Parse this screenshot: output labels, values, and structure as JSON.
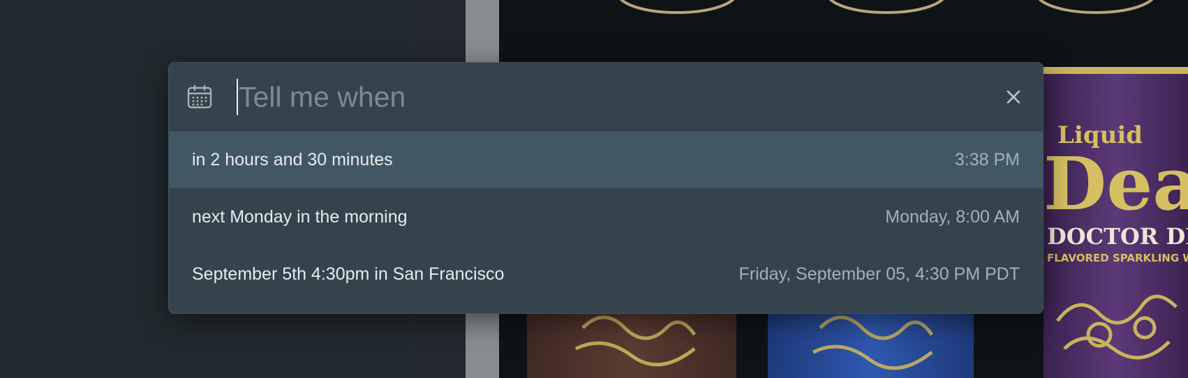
{
  "dialog": {
    "input": {
      "value": "",
      "placeholder": "Tell me when"
    },
    "icons": {
      "leading": "calendar-icon",
      "close": "close-icon"
    },
    "suggestions": [
      {
        "label": "in 2 hours and 30 minutes",
        "time": "3:38 PM",
        "selected": true
      },
      {
        "label": "next Monday in the morning",
        "time": "Monday, 8:00 AM",
        "selected": false
      },
      {
        "label": "September 5th 4:30pm in San Francisco",
        "time": "Friday, September 05, 4:30 PM PDT",
        "selected": false
      }
    ]
  },
  "background": {
    "can": {
      "brand": "Liquid",
      "brand_large": "Deat",
      "flavor": "DOCTOR DEA",
      "subtitle": "FLAVORED SPARKLING WAT"
    }
  },
  "colors": {
    "modal_bg": "#35434c",
    "selected_row": "#425764",
    "text": "#e6ecef",
    "secondary_text": "#a6b0b6",
    "placeholder": "#7e8a91",
    "can_purple": "#4a2c63",
    "can_gold": "#d6bf62"
  }
}
